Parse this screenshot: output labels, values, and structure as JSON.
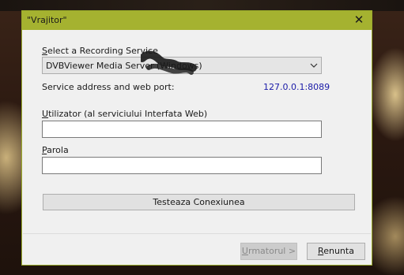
{
  "window": {
    "title": "\"Vrajitor\"",
    "close_glyph": "✕"
  },
  "service": {
    "label_accel": "S",
    "label_rest": "elect a Recording Service",
    "selected": "DVBViewer Media Server (Windows)"
  },
  "address": {
    "label": "Service address and web port:",
    "value": "127.0.0.1:8089"
  },
  "user": {
    "label_accel": "U",
    "label_rest": "tilizator (al serviciului Interfata Web)",
    "value": ""
  },
  "password": {
    "label_accel": "P",
    "label_rest": "arola",
    "value": ""
  },
  "buttons": {
    "test": "Testeaza Conexiunea",
    "next_accel": "U",
    "next_rest": "rmatorul >",
    "cancel_accel": "R",
    "cancel_rest": "enunta"
  },
  "colors": {
    "titlebar": "#a5b230",
    "address_value": "#1b1ba8"
  }
}
